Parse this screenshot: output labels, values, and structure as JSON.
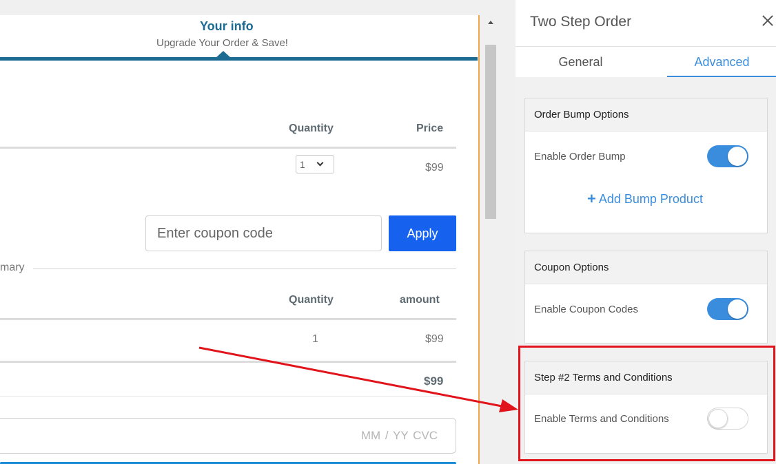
{
  "preview": {
    "step": {
      "title": "Your info",
      "subtitle": "Upgrade Your Order & Save!"
    },
    "order_table": {
      "headers": [
        "Quantity",
        "Price"
      ],
      "quantity_value": "1",
      "price": "$99"
    },
    "coupon": {
      "placeholder": "Enter coupon code",
      "apply_label": "Apply"
    },
    "summary": {
      "label_fragment": "mary",
      "headers": [
        "Quantity",
        "amount"
      ],
      "quantity": "1",
      "amount": "$99",
      "total": "$99"
    },
    "card": {
      "placeholder": "MM / YY  CVC"
    }
  },
  "panel": {
    "title": "Two Step Order",
    "tabs": [
      {
        "label": "General",
        "active": false
      },
      {
        "label": "Advanced",
        "active": true
      }
    ],
    "sections": [
      {
        "title": "Order Bump Options",
        "row_label": "Enable Order Bump",
        "enabled": true,
        "action_label": "Add Bump Product"
      },
      {
        "title": "Coupon Options",
        "row_label": "Enable Coupon Codes",
        "enabled": true
      },
      {
        "title": "Step #2 Terms and Conditions",
        "row_label": "Enable Terms and Conditions",
        "enabled": false
      }
    ]
  },
  "colors": {
    "accent": "#3a8ddd",
    "step_accent": "#1b6b93",
    "apply_button": "#1662ee",
    "annotation": "#e0141a"
  },
  "icons": [
    "close-icon",
    "plus-icon",
    "chevron-down-icon",
    "scroll-up-arrow-icon",
    "annotation-arrow"
  ]
}
